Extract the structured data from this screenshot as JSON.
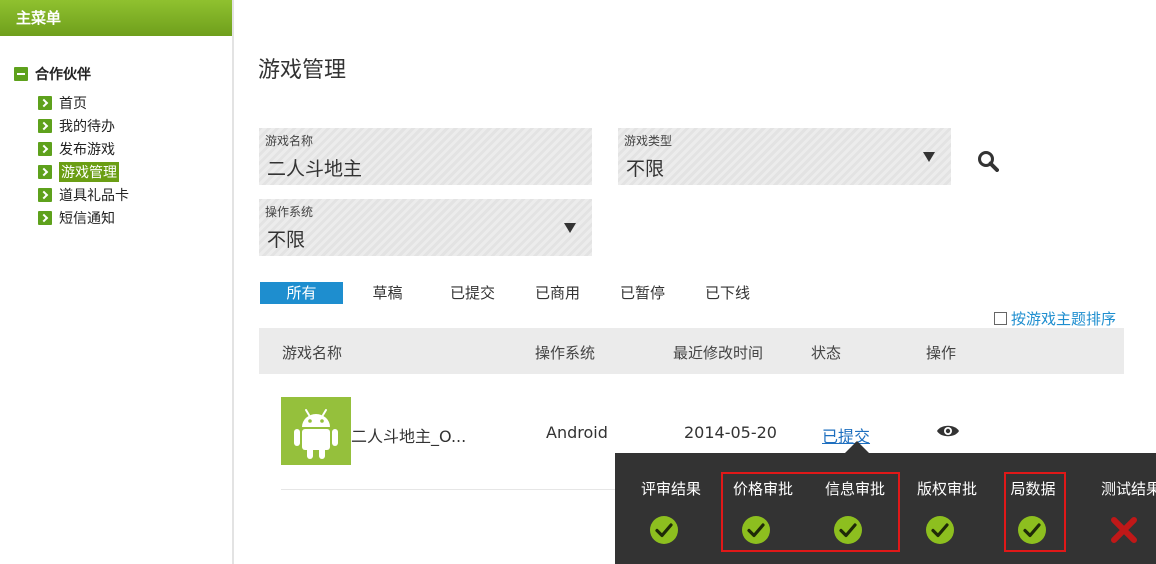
{
  "sidebar": {
    "header": "主菜单",
    "group": "合作伙伴",
    "items": [
      {
        "label": "首页",
        "active": false
      },
      {
        "label": "我的待办",
        "active": false
      },
      {
        "label": "发布游戏",
        "active": false
      },
      {
        "label": "游戏管理",
        "active": true
      },
      {
        "label": "道具礼品卡",
        "active": false
      },
      {
        "label": "短信通知",
        "active": false
      }
    ]
  },
  "page": {
    "title": "游戏管理"
  },
  "filters": {
    "game_name": {
      "label": "游戏名称",
      "value": "二人斗地主"
    },
    "game_type": {
      "label": "游戏类型",
      "value": "不限"
    },
    "os": {
      "label": "操作系统",
      "value": "不限"
    }
  },
  "tabs": [
    "所有",
    "草稿",
    "已提交",
    "已商用",
    "已暂停",
    "已下线"
  ],
  "sort_option": "按游戏主题排序",
  "table": {
    "headers": [
      "游戏名称",
      "操作系统",
      "最近修改时间",
      "状态",
      "操作"
    ],
    "rows": [
      {
        "name": "二人斗地主_O...",
        "os": "Android",
        "modified": "2014-05-20",
        "status": "已提交"
      }
    ]
  },
  "review_popup": {
    "columns": [
      {
        "label": "评审结果",
        "result": "pass"
      },
      {
        "label": "价格审批",
        "result": "pass"
      },
      {
        "label": "信息审批",
        "result": "pass"
      },
      {
        "label": "版权审批",
        "result": "pass"
      },
      {
        "label": "局数据",
        "result": "pass"
      },
      {
        "label": "测试结果",
        "result": "fail"
      }
    ]
  },
  "colors": {
    "sidebar_header": "#7aad22",
    "accent_blue": "#1e8ecf",
    "pass_green": "#8dbf1f",
    "fail_red": "#c01818",
    "highlight_red": "#e01818",
    "popup_bg": "#333333"
  }
}
